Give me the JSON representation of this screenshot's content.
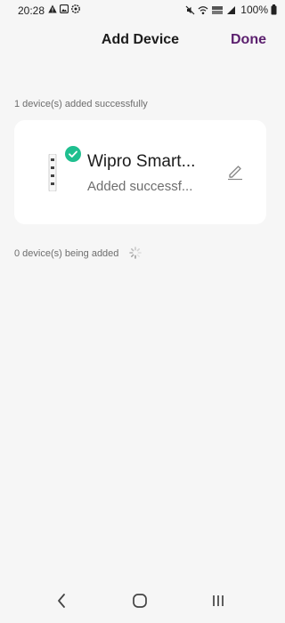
{
  "status_bar": {
    "time": "20:28",
    "battery_percent": "100%",
    "left_icons": [
      "warning-icon",
      "gallery-icon",
      "settings-wheel-icon"
    ],
    "right_icons": [
      "mute-icon",
      "wifi-icon",
      "volte-icon",
      "signal-icon",
      "battery-icon"
    ]
  },
  "header": {
    "title": "Add Device",
    "done_label": "Done",
    "done_color": "#5b1f6e"
  },
  "added_section": {
    "label": "1 device(s) added successfully"
  },
  "device_card": {
    "name": "Wipro Smart...",
    "status": "Added successf...",
    "badge_color": "#1fbf8f",
    "icons": [
      "power-strip-icon",
      "check-badge-icon",
      "edit-pencil-icon"
    ]
  },
  "adding_section": {
    "label": "0 device(s) being added",
    "icon": "loading-spinner-icon"
  },
  "nav_bar": {
    "icons": [
      "back-icon",
      "home-icon",
      "recents-icon"
    ]
  }
}
